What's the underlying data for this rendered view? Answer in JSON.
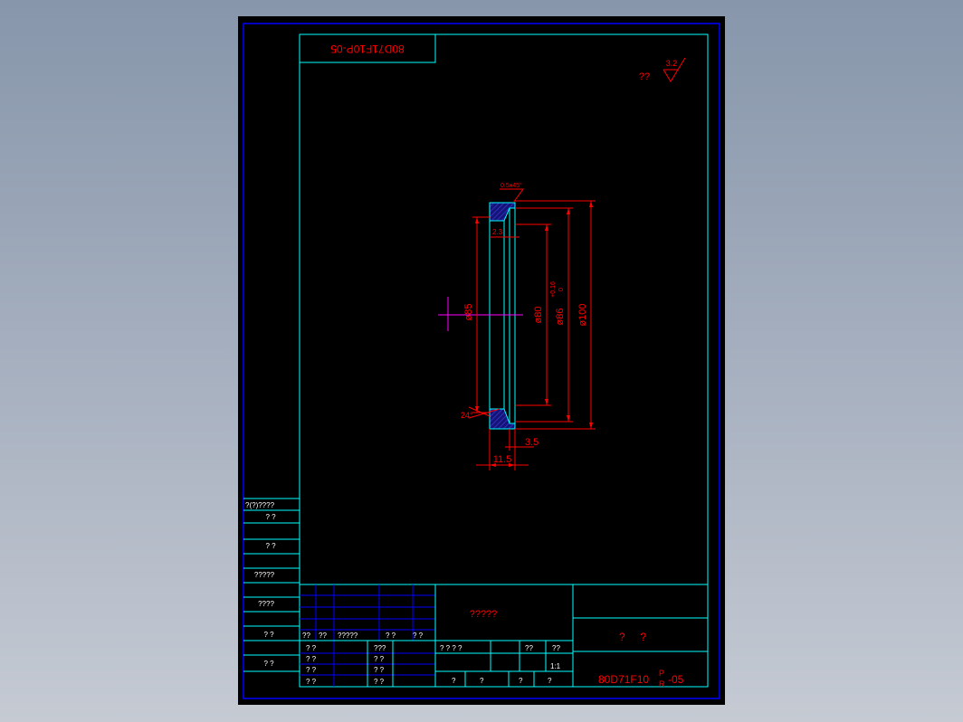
{
  "drawing": {
    "code_rotated": "80D71F10P-05",
    "code": "80D71F10",
    "code_sup": "P",
    "code_sub": "R",
    "code_suffix": "-05",
    "roughness_label": "??",
    "roughness_value": "3.2",
    "colors": {
      "background": "#000000",
      "frame": "#0000ff",
      "cyan": "#00ffff",
      "dimension": "#ff0000",
      "section_fill": "#1a1a8c",
      "centerline": "#ff00ff",
      "white": "#ffffff"
    }
  },
  "dimensions": {
    "chamfer": "0.5x45°",
    "d_inner_small": "2.3",
    "d85": "ø85",
    "d80": "ø80",
    "d86": "ø86",
    "d86_tol": "+0.16",
    "d86_tol2": "0",
    "d100": "ø100",
    "angle": "24°",
    "w_3_5": "3.5",
    "w_11_5": "11.5"
  },
  "left_column": {
    "header": "?(?)????",
    "rows": [
      "?  ?",
      "?  ?",
      "?????",
      "????",
      "?  ?",
      "?  ?"
    ]
  },
  "title_block": {
    "center_label": "?????",
    "name": "?     ?",
    "header_cells": [
      "??",
      "??",
      "?????",
      "?  ?",
      "?  ?"
    ],
    "sign_rows": [
      "?  ?",
      "?  ?",
      "?  ?",
      "?  ?"
    ],
    "sign_rows_mid": [
      "???",
      "?  ?",
      "?  ?",
      "?  ?"
    ],
    "stage_labels": [
      "?  ?  ?  ?",
      "??",
      "??"
    ],
    "scale": "1:1",
    "sheet_labels": [
      "?",
      "?",
      "?",
      "?"
    ]
  }
}
